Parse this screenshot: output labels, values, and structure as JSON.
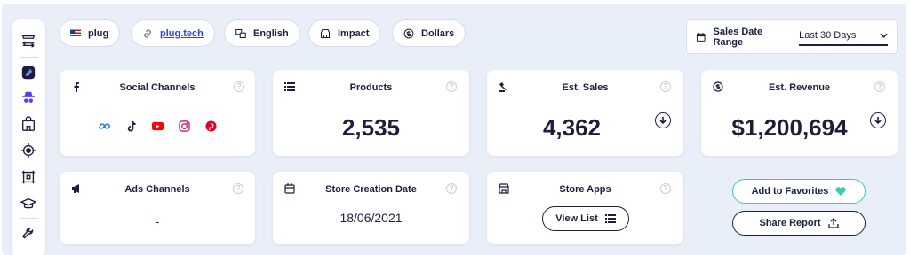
{
  "filters": {
    "store": "plug",
    "domain": "plug.tech",
    "language": "English",
    "sort": "Impact",
    "currency": "Dollars"
  },
  "date_range": {
    "label": "Sales Date Range",
    "value": "Last 30 Days"
  },
  "cards": {
    "social": {
      "title": "Social Channels"
    },
    "products": {
      "title": "Products",
      "value": "2,535"
    },
    "sales": {
      "title": "Est. Sales",
      "value": "4,362"
    },
    "revenue": {
      "title": "Est. Revenue",
      "value": "$1,200,694"
    },
    "ads": {
      "title": "Ads Channels",
      "value": "-"
    },
    "creation": {
      "title": "Store Creation Date",
      "value": "18/06/2021"
    },
    "apps": {
      "title": "Store Apps",
      "button": "View List"
    }
  },
  "actions": {
    "favorites": "Add to Favorites",
    "share": "Share Report"
  },
  "help_glyph": "?",
  "colors": {
    "background": "#e9eff9",
    "text": "#1e1e3c",
    "accent_teal": "#3cc8b4",
    "link": "#2a48d6",
    "meta": "#1877f2",
    "youtube": "#ff0000",
    "instagram": "#d62976",
    "pinterest": "#e60023"
  }
}
